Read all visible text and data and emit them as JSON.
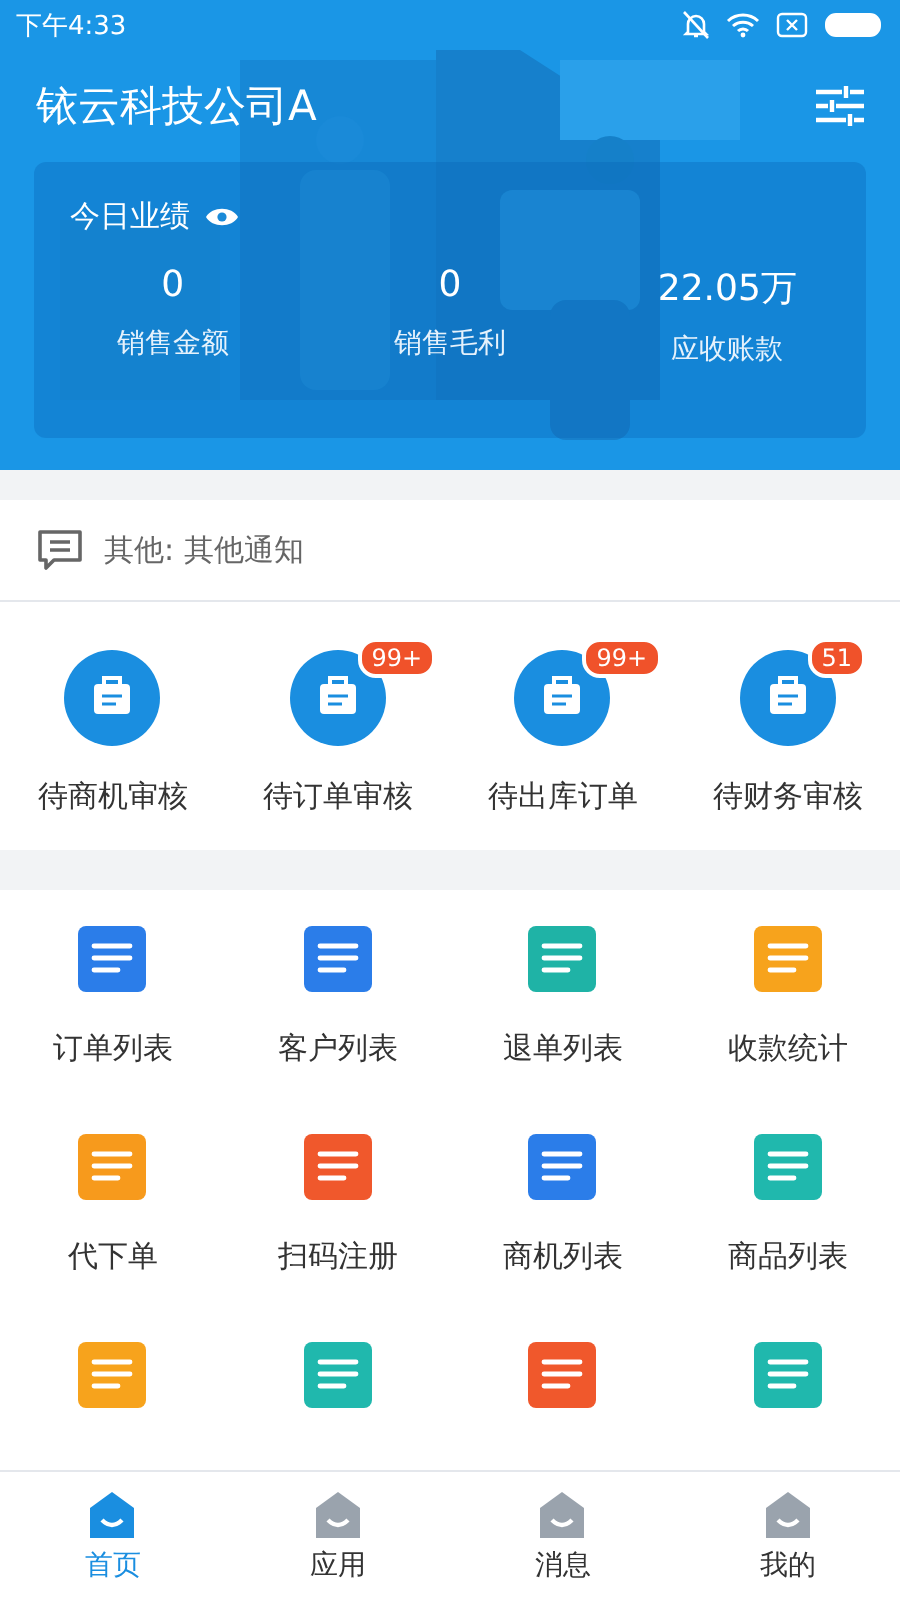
{
  "status_bar": {
    "time": "下午4:33"
  },
  "header": {
    "title": "铱云科技公司A"
  },
  "performance": {
    "title": "今日业绩",
    "stats": [
      {
        "value": "0",
        "label": "销售金额"
      },
      {
        "value": "0",
        "label": "销售毛利"
      },
      {
        "value": "22.05万",
        "label": "应收账款"
      }
    ]
  },
  "notice": {
    "text": "其他: 其他通知"
  },
  "pending": [
    {
      "label": "待商机审核"
    },
    {
      "label": "待订单审核",
      "badge": "99+"
    },
    {
      "label": "待出库订单",
      "badge": "99+"
    },
    {
      "label": "待财务审核",
      "badge": "51"
    }
  ],
  "apps": [
    {
      "kind": "labeled",
      "label": "订单列表"
    },
    {
      "kind": "labeled",
      "label": "客户列表"
    },
    {
      "kind": "labeled",
      "label": "退单列表"
    },
    {
      "kind": "labeled",
      "label": "收款统计"
    },
    {
      "kind": "labeled",
      "label": "代下单"
    },
    {
      "kind": "labeled",
      "label": "扫码注册"
    },
    {
      "kind": "labeled",
      "label": "商机列表"
    },
    {
      "kind": "labeled",
      "label": "商品列表"
    },
    {
      "kind": "cut"
    },
    {
      "kind": "cut"
    },
    {
      "kind": "cut"
    },
    {
      "kind": "cut"
    }
  ],
  "tab_bar": [
    {
      "label": "首页",
      "selected": true
    },
    {
      "label": "应用",
      "selected": false
    },
    {
      "label": "消息",
      "selected": false
    },
    {
      "label": "我的",
      "selected": false
    }
  ]
}
